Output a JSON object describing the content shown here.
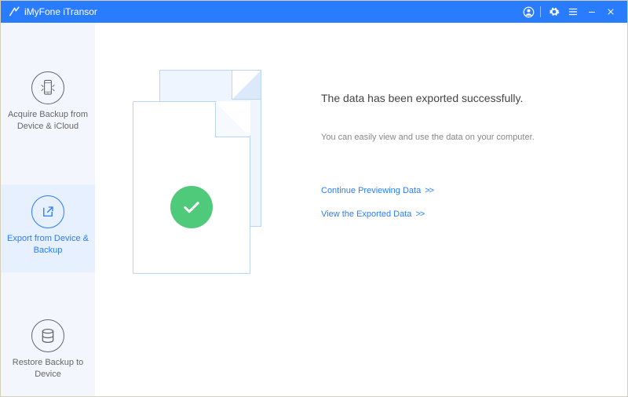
{
  "app": {
    "title": "iMyFone iTransor"
  },
  "sidebar": {
    "items": [
      {
        "label": "Acquire Backup from Device & iCloud"
      },
      {
        "label": "Export from Device & Backup"
      },
      {
        "label": "Restore Backup to Device"
      }
    ]
  },
  "main": {
    "headline": "The data has been exported successfully.",
    "subtext": "You can easily view and use the data on your computer.",
    "links": {
      "continue": "Continue Previewing Data",
      "view": "View the Exported Data",
      "suffix": ">>"
    }
  },
  "icons": {
    "phone": "phone-icon",
    "export": "export-icon",
    "db": "database-icon",
    "check": "check-icon"
  }
}
